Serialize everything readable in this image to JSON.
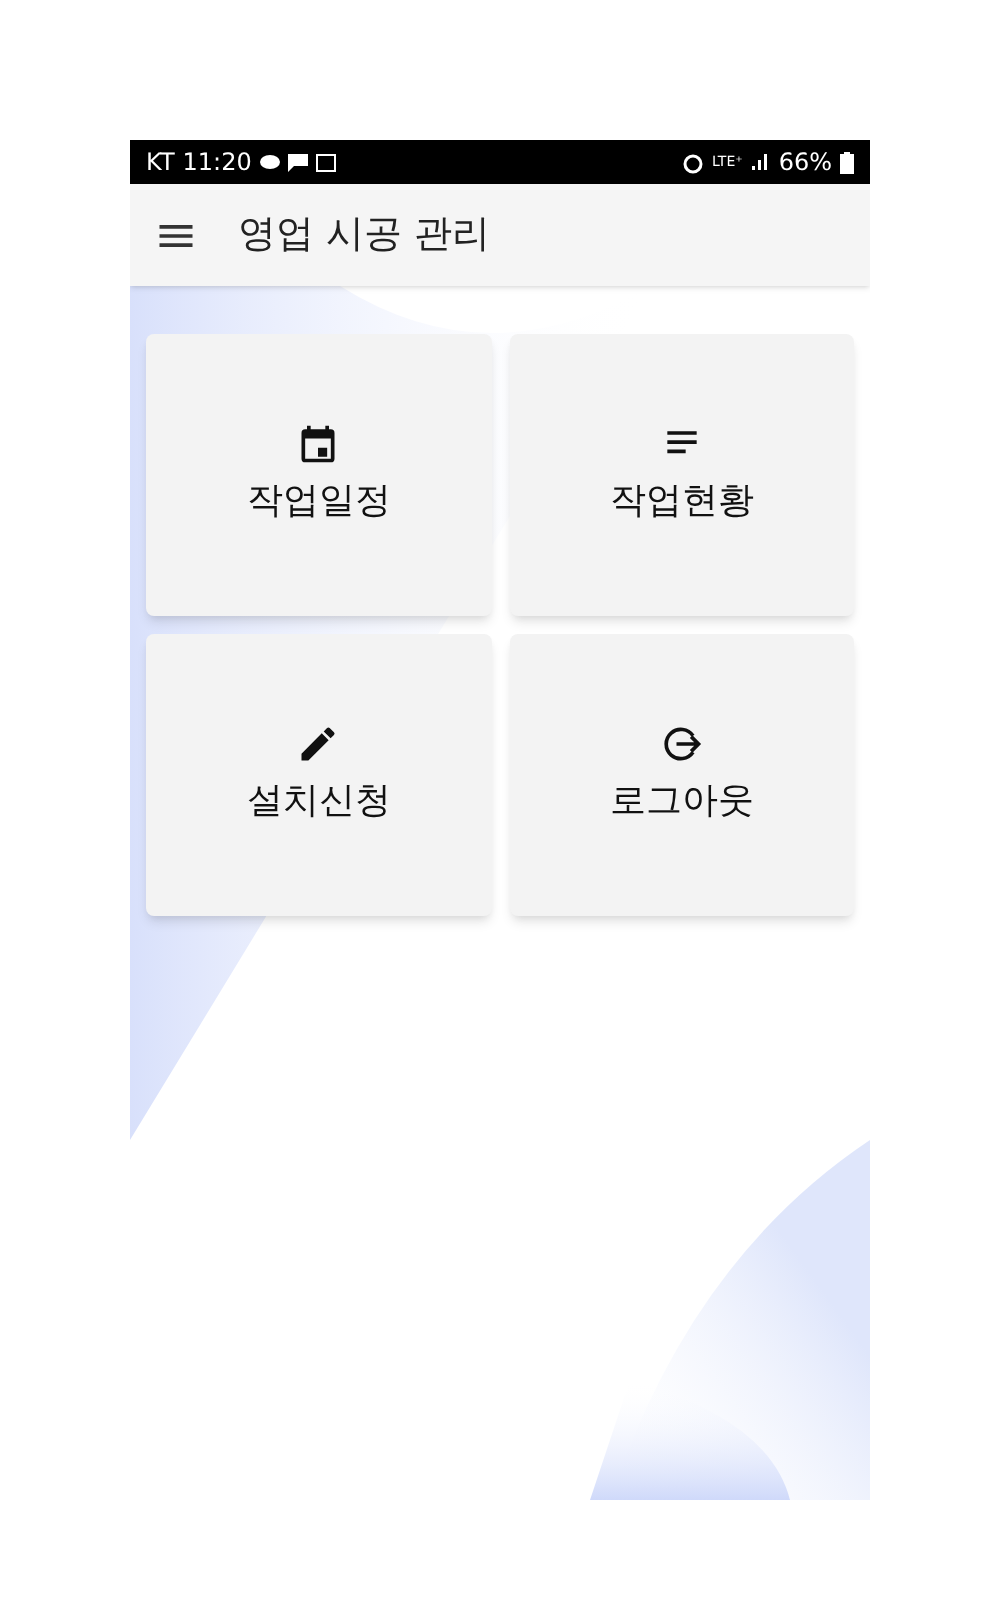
{
  "status_bar": {
    "carrier": "KT",
    "time": "11:20",
    "network": "LTE⁺",
    "battery": "66%"
  },
  "app_bar": {
    "title": "영업 시공 관리"
  },
  "menu": [
    {
      "label": "작업일정",
      "kind": "calendar"
    },
    {
      "label": "작업현황",
      "kind": "list"
    },
    {
      "label": "설치신청",
      "kind": "pencil"
    },
    {
      "label": "로그아웃",
      "kind": "logout"
    }
  ]
}
